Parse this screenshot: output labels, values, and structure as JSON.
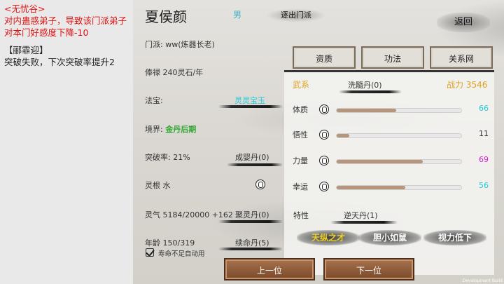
{
  "log": {
    "line1": "<无忧谷>",
    "line2": "对内蛊惑弟子，导致该门派弟子对本门好感度下降-10",
    "line3": "【郦霏迎】",
    "line4": "突破失败，下次突破率提升2"
  },
  "character": {
    "name": "夏侯颜",
    "gender": "男",
    "expel_label": "逐出门派",
    "sect_label": "门派: ww(炼器长老)",
    "salary_label": "俸禄 240灵石/年",
    "treasure_label": "法宝:",
    "treasure_value": "灵灵宝玉",
    "realm_label": "境界:",
    "realm_value": "金丹后期",
    "breakthrough_label": "突破率: 21%",
    "breakthrough_item": "成婴丹(0)",
    "root_label": "灵根 水",
    "qi_label": "灵气 5184/20000 +162",
    "qi_item": "聚灵丹(0)",
    "age_label": "年龄 150/319",
    "age_item": "续命丹(5)",
    "auto_use_label": "寿命不足自动用"
  },
  "back_label": "返回",
  "tabs": [
    "资质",
    "功法",
    "关系网"
  ],
  "panel": {
    "attr_label": "武系",
    "attr_item": "洗髓丹(0)",
    "power_label": "战力 3546",
    "stats": [
      {
        "name": "体质",
        "value": "66",
        "level": 0.48,
        "color": "#22c8d8"
      },
      {
        "name": "悟性",
        "value": "11",
        "level": 0.1,
        "color": "#333333"
      },
      {
        "name": "力量",
        "value": "69",
        "level": 0.69,
        "color": "#d020d0"
      },
      {
        "name": "幸运",
        "value": "56",
        "level": 0.55,
        "color": "#22c8d8"
      }
    ],
    "trait_label": "特性",
    "trait_item": "逆天丹(1)",
    "traits": [
      {
        "label": "天纵之才",
        "color": "#f0d020"
      },
      {
        "label": "胆小如鼠",
        "color": "#ffffff"
      },
      {
        "label": "视力低下",
        "color": "#ffffff"
      }
    ]
  },
  "nav": {
    "prev": "上一位",
    "next": "下一位"
  },
  "dev_build": "Development Build"
}
